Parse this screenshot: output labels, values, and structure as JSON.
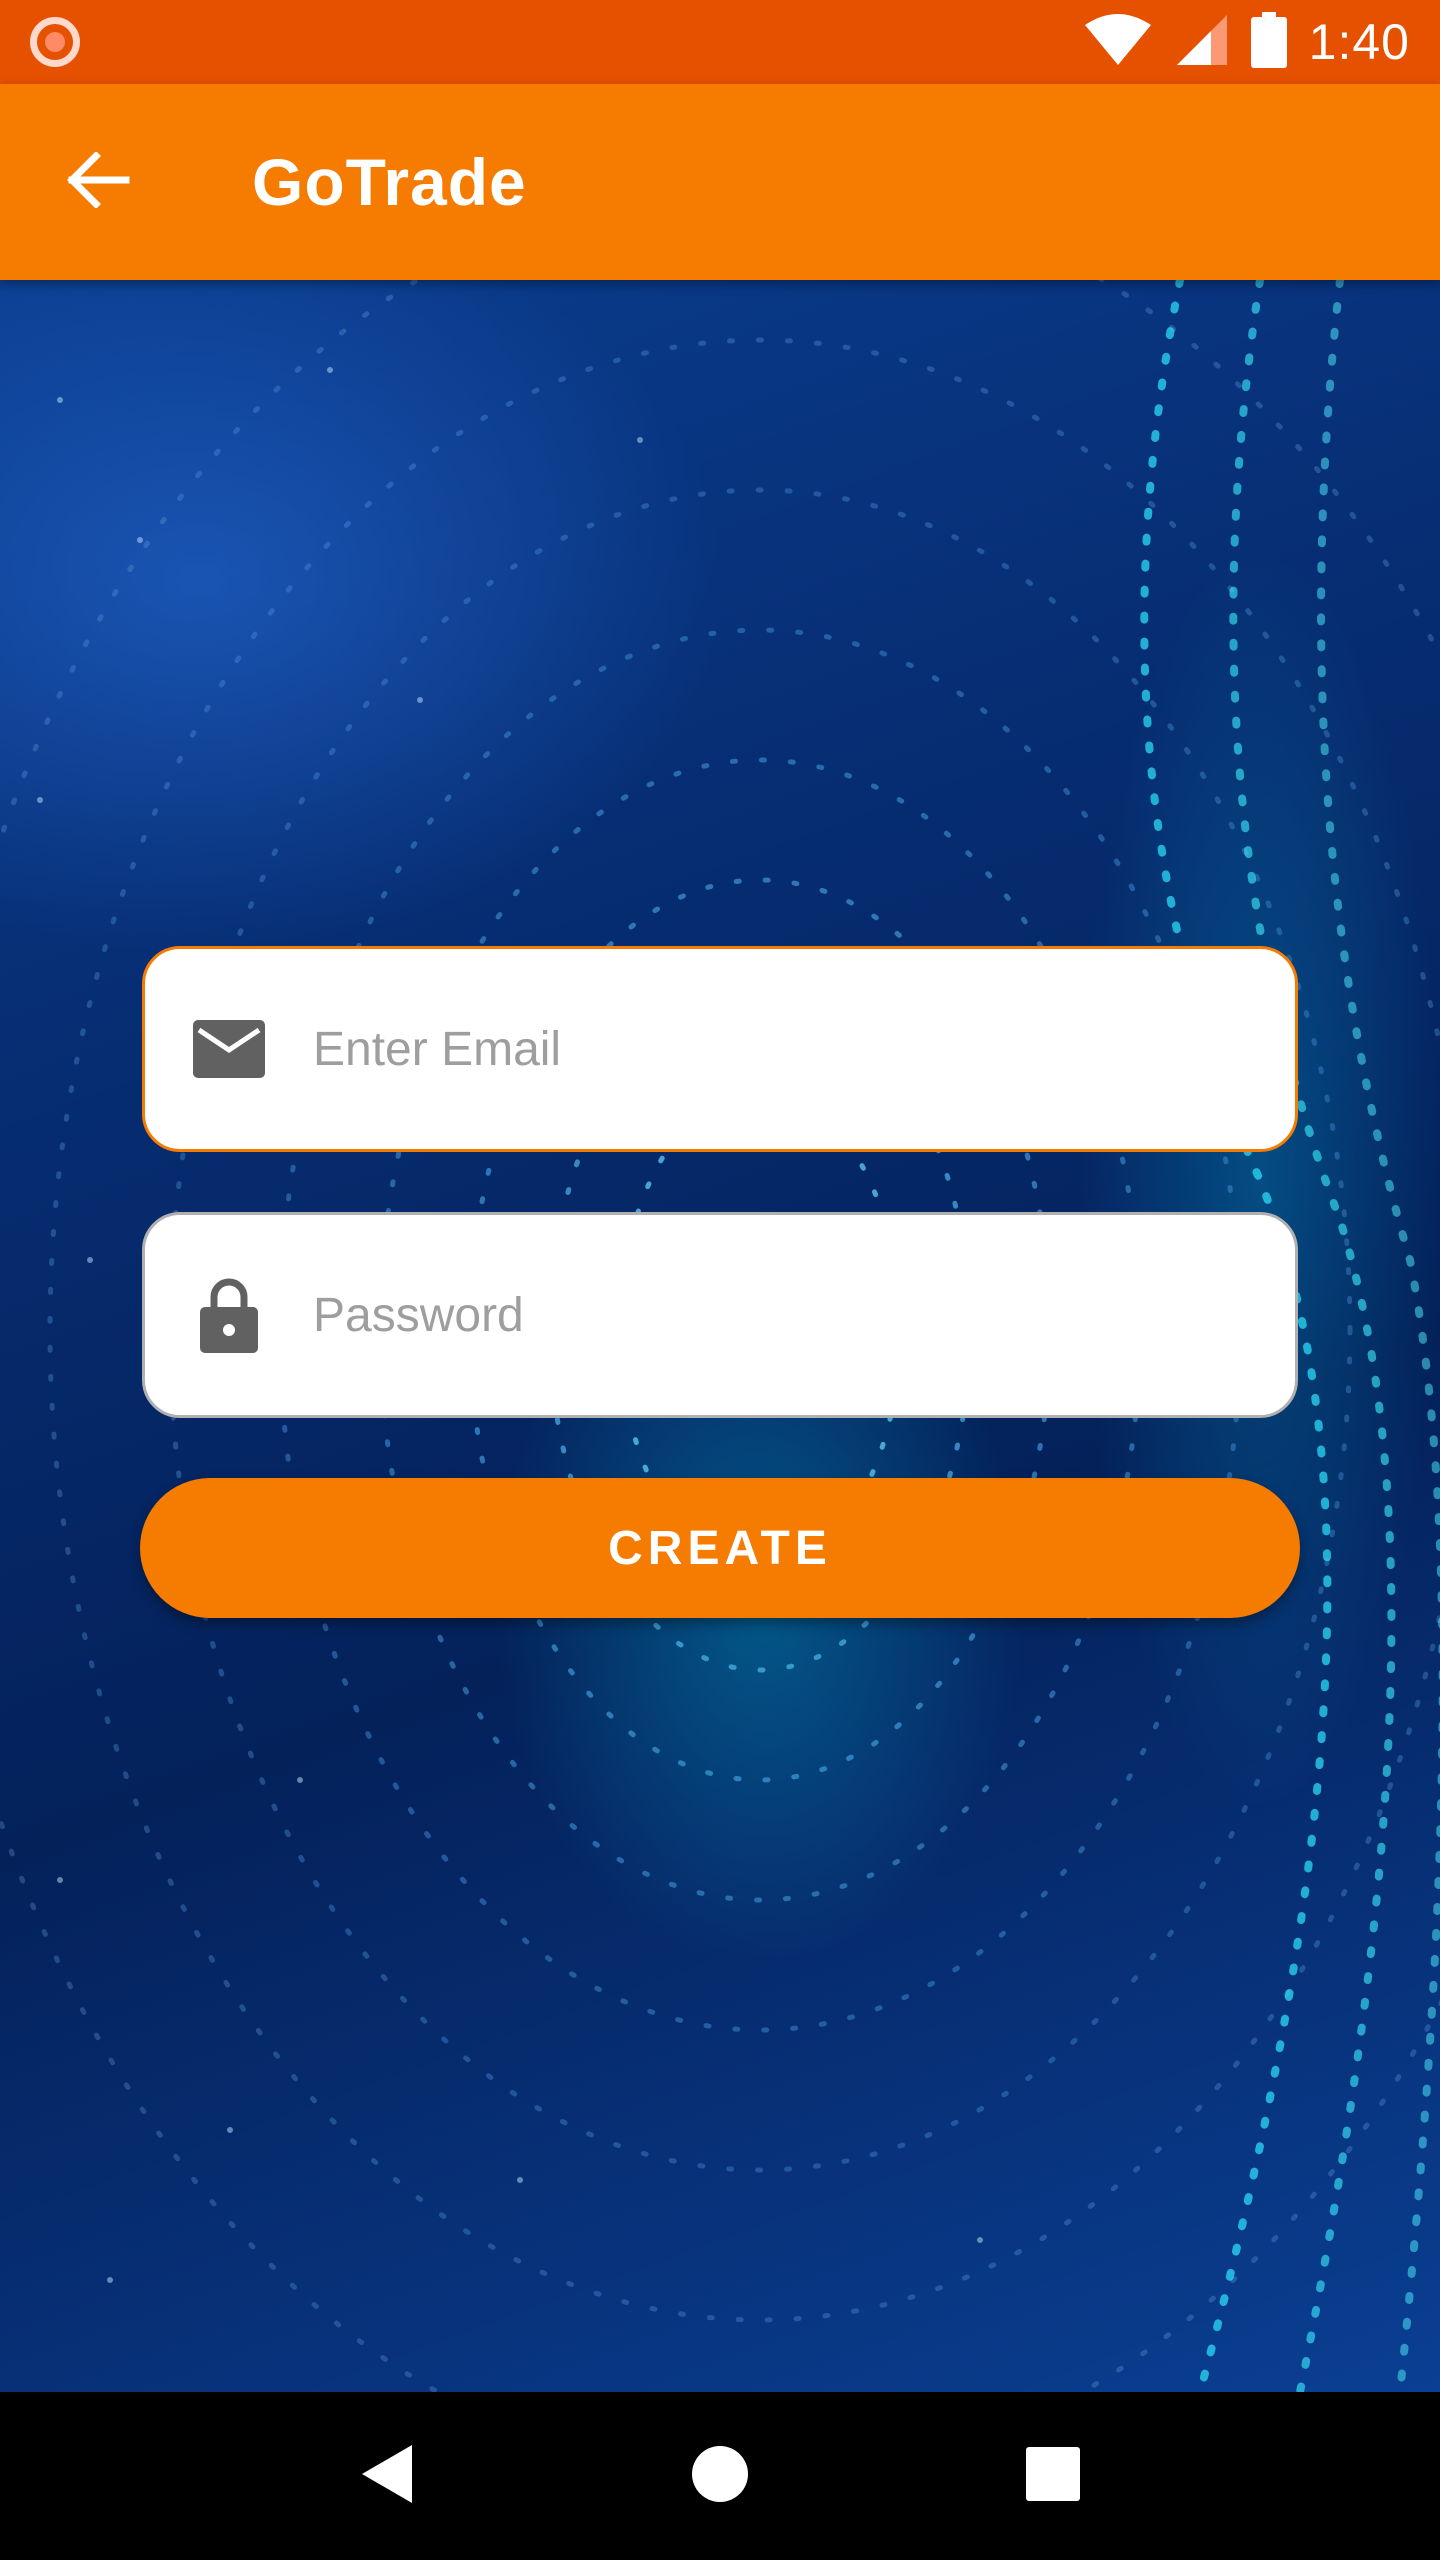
{
  "status_bar": {
    "time": "1:40",
    "icons": [
      "notification-record-icon",
      "wifi-icon",
      "cell-signal-icon",
      "battery-icon"
    ]
  },
  "app_bar": {
    "title": "GoTrade",
    "back_icon": "arrow-back-icon"
  },
  "form": {
    "email": {
      "placeholder": "Enter Email",
      "value": "",
      "icon": "mail-icon"
    },
    "password": {
      "placeholder": "Password",
      "value": "",
      "icon": "lock-icon"
    },
    "submit_label": "CREATE"
  },
  "nav_bar": {
    "buttons": [
      "back-triangle-icon",
      "home-circle-icon",
      "recents-square-icon"
    ]
  },
  "colors": {
    "status_bar": "#e65100",
    "app_bar": "#f57c00",
    "accent": "#f57c00",
    "background": "#062b6e"
  }
}
